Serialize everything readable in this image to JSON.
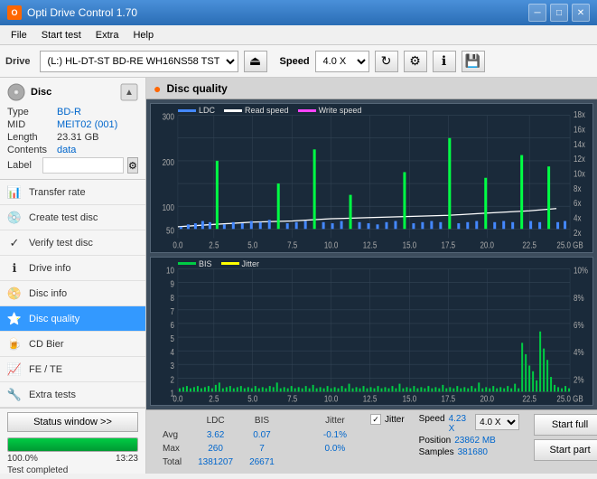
{
  "titleBar": {
    "title": "Opti Drive Control 1.70",
    "minBtn": "─",
    "maxBtn": "□",
    "closeBtn": "✕"
  },
  "menuBar": {
    "items": [
      "File",
      "Start test",
      "Extra",
      "Help"
    ]
  },
  "toolbar": {
    "driveLabel": "Drive",
    "driveValue": "(L:)  HL-DT-ST BD-RE  WH16NS58 TST4",
    "speedLabel": "Speed",
    "speedValue": "4.0 X"
  },
  "disc": {
    "title": "Disc",
    "typeLabel": "Type",
    "typeValue": "BD-R",
    "midLabel": "MID",
    "midValue": "MEIT02 (001)",
    "lengthLabel": "Length",
    "lengthValue": "23.31 GB",
    "contentsLabel": "Contents",
    "contentsValue": "data",
    "labelLabel": "Label",
    "labelValue": ""
  },
  "navItems": [
    {
      "id": "transfer-rate",
      "label": "Transfer rate",
      "icon": "📊"
    },
    {
      "id": "create-test-disc",
      "label": "Create test disc",
      "icon": "💿"
    },
    {
      "id": "verify-test-disc",
      "label": "Verify test disc",
      "icon": "✓"
    },
    {
      "id": "drive-info",
      "label": "Drive info",
      "icon": "ℹ"
    },
    {
      "id": "disc-info",
      "label": "Disc info",
      "icon": "📀"
    },
    {
      "id": "disc-quality",
      "label": "Disc quality",
      "icon": "⭐",
      "active": true
    },
    {
      "id": "cd-bier",
      "label": "CD Bier",
      "icon": "🍺"
    },
    {
      "id": "fe-te",
      "label": "FE / TE",
      "icon": "📈"
    },
    {
      "id": "extra-tests",
      "label": "Extra tests",
      "icon": "🔧"
    }
  ],
  "statusWindow": {
    "btnLabel": "Status window >>",
    "progressPercent": 100,
    "progressLabel": "100.0%",
    "timeLabel": "13:23",
    "statusText": "Test completed"
  },
  "contentHeader": {
    "title": "Disc quality"
  },
  "chart1": {
    "legend": [
      {
        "label": "LDC",
        "color": "#4488ff"
      },
      {
        "label": "Read speed",
        "color": "#ffffff"
      },
      {
        "label": "Write speed",
        "color": "#ff44ff"
      }
    ],
    "yAxisRight": [
      "18x",
      "16x",
      "14x",
      "12x",
      "10x",
      "8x",
      "6x",
      "4x",
      "2x"
    ],
    "yAxisLeft": [
      "300",
      "200",
      "100",
      "50"
    ],
    "xAxisLabels": [
      "0.0",
      "2.5",
      "5.0",
      "7.5",
      "10.0",
      "12.5",
      "15.0",
      "17.5",
      "20.0",
      "22.5",
      "25.0 GB"
    ]
  },
  "chart2": {
    "legend": [
      {
        "label": "BIS",
        "color": "#00cc44"
      },
      {
        "label": "Jitter",
        "color": "#ffff00"
      }
    ],
    "yAxisRight": [
      "10%",
      "8%",
      "6%",
      "4%",
      "2%"
    ],
    "yAxisLeft": [
      "10",
      "9",
      "8",
      "7",
      "6",
      "5",
      "4",
      "3",
      "2",
      "1"
    ],
    "xAxisLabels": [
      "0.0",
      "2.5",
      "5.0",
      "7.5",
      "10.0",
      "12.5",
      "15.0",
      "17.5",
      "20.0",
      "22.5",
      "25.0 GB"
    ]
  },
  "stats": {
    "columns": [
      "LDC",
      "BIS",
      "",
      "Jitter",
      "Speed",
      ""
    ],
    "rows": [
      {
        "label": "Avg",
        "ldc": "3.62",
        "bis": "0.07",
        "sep": "",
        "jitter": "-0.1%",
        "speed": "4.23 X",
        "speedSel": "4.0 X"
      },
      {
        "label": "Max",
        "ldc": "260",
        "bis": "7",
        "sep": "",
        "jitter": "0.0%",
        "speed_label": "Position",
        "position": "23862 MB"
      },
      {
        "label": "Total",
        "ldc": "1381207",
        "bis": "26671",
        "sep": "",
        "jitter": "",
        "speed_label": "Samples",
        "samples": "381680"
      }
    ],
    "jitterChecked": true,
    "jitterLabel": "Jitter",
    "speedLabel": "Speed",
    "speedValue": "4.23 X",
    "speedSelectValue": "4.0 X",
    "positionLabel": "Position",
    "positionValue": "23862 MB",
    "samplesLabel": "Samples",
    "samplesValue": "381680",
    "startFullBtn": "Start full",
    "startPartBtn": "Start part"
  }
}
